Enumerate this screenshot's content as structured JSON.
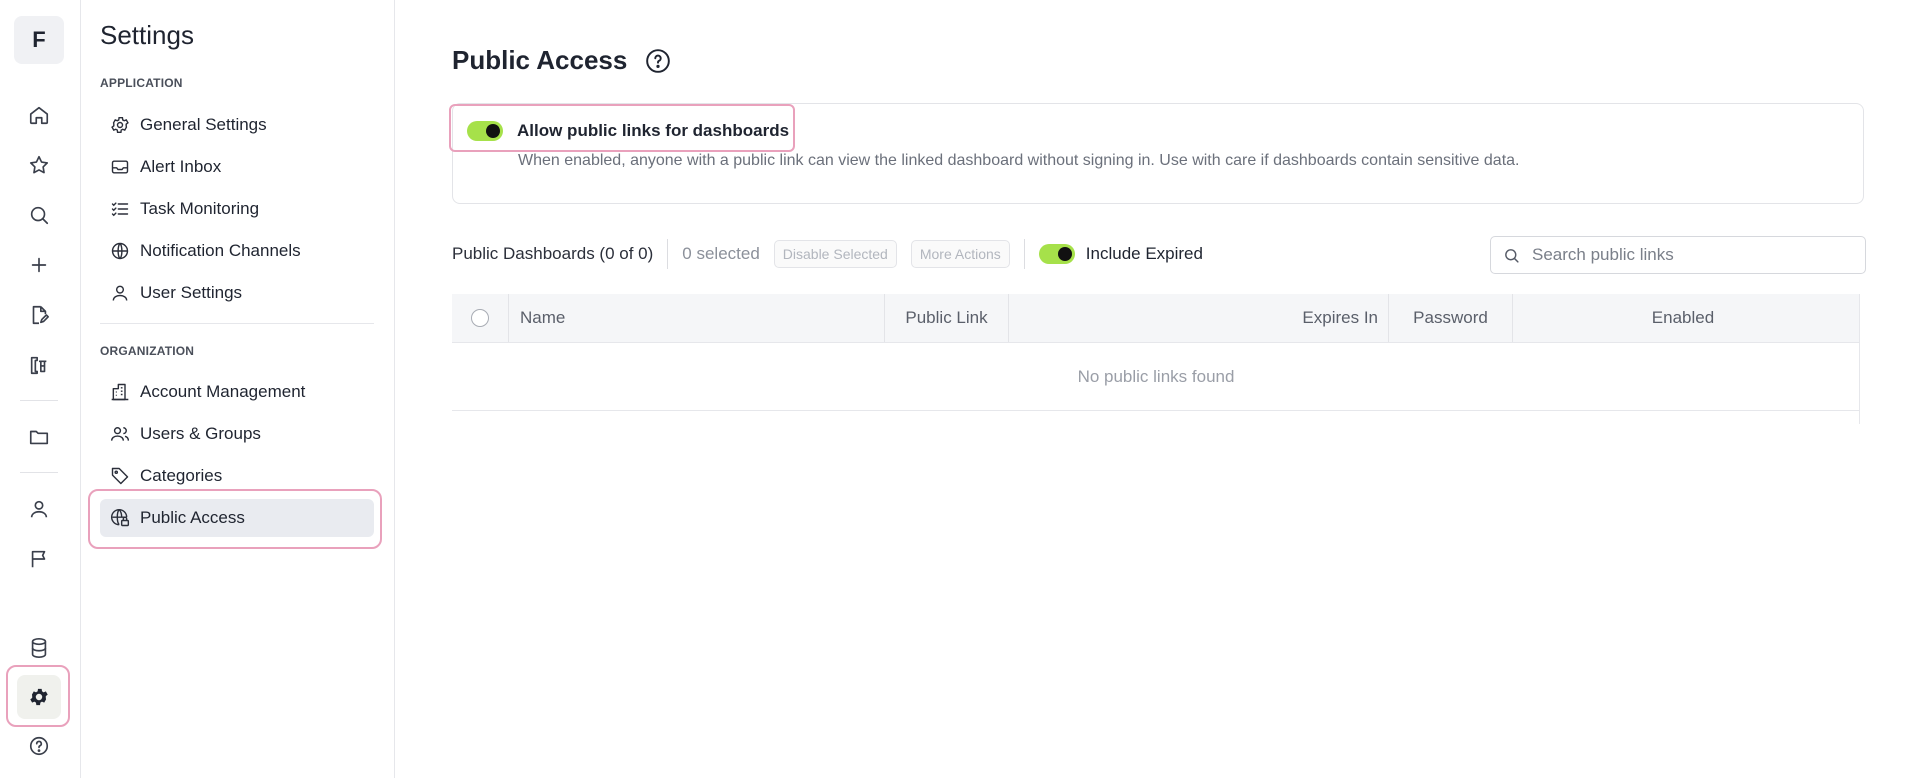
{
  "rail": {
    "logo": "F",
    "icons": [
      "home-icon",
      "star-icon",
      "search-icon",
      "plus-icon",
      "edit-document-icon",
      "beaker-icon",
      "folder-icon",
      "user-icon",
      "flag-icon",
      "database-icon",
      "gear-icon",
      "help-icon"
    ]
  },
  "sidebar": {
    "title": "Settings",
    "sections": [
      {
        "label": "APPLICATION",
        "items": [
          {
            "label": "General Settings",
            "icon": "gear-outline-icon"
          },
          {
            "label": "Alert Inbox",
            "icon": "inbox-icon"
          },
          {
            "label": "Task Monitoring",
            "icon": "list-check-icon"
          },
          {
            "label": "Notification Channels",
            "icon": "broadcast-icon"
          },
          {
            "label": "User Settings",
            "icon": "user-icon"
          }
        ]
      },
      {
        "label": "ORGANIZATION",
        "items": [
          {
            "label": "Account Management",
            "icon": "building-icon"
          },
          {
            "label": "Users & Groups",
            "icon": "users-icon"
          },
          {
            "label": "Categories",
            "icon": "tag-icon"
          },
          {
            "label": "Public Access",
            "icon": "globe-lock-icon",
            "active": true
          }
        ]
      }
    ]
  },
  "main": {
    "title": "Public Access",
    "allow": {
      "label": "Allow public links for dashboards",
      "description": "When enabled, anyone with a public link can view the linked dashboard without signing in. Use with care if dashboards contain sensitive data.",
      "enabled": true
    },
    "toolbar": {
      "count": "Public Dashboards (0 of 0)",
      "selected": "0 selected",
      "disable_selected": "Disable Selected",
      "more_actions": "More Actions",
      "include_expired": "Include Expired",
      "include_expired_on": true
    },
    "search": {
      "placeholder": "Search public links",
      "value": ""
    },
    "table": {
      "columns": [
        "Name",
        "Public Link",
        "Expires In",
        "Password",
        "Enabled"
      ],
      "empty": "No public links found"
    }
  },
  "colors": {
    "accent_toggle": "#a6e14a",
    "highlight": "#e9a1bc"
  }
}
